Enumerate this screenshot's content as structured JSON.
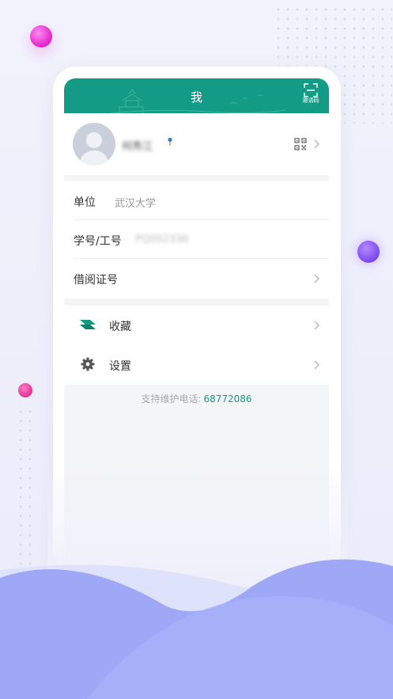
{
  "header": {
    "title": "我",
    "invite_label": "邀请码"
  },
  "profile": {
    "name": "何秀江"
  },
  "info": {
    "rows": [
      {
        "label": "单位",
        "value": "武汉大学"
      },
      {
        "label": "学号/工号",
        "value": "PQ002336"
      },
      {
        "label": "借阅证号",
        "value": ""
      }
    ]
  },
  "menu": {
    "items": [
      {
        "label": "收藏",
        "icon": "bookmark-stack-icon"
      },
      {
        "label": "设置",
        "icon": "gear-icon"
      }
    ]
  },
  "support": {
    "label": "支持维护电话:",
    "phone": "68772086"
  },
  "colors": {
    "brand": "#149b86",
    "wave_primary": "#9ea8f7",
    "wave_secondary": "#d8dbfa"
  }
}
